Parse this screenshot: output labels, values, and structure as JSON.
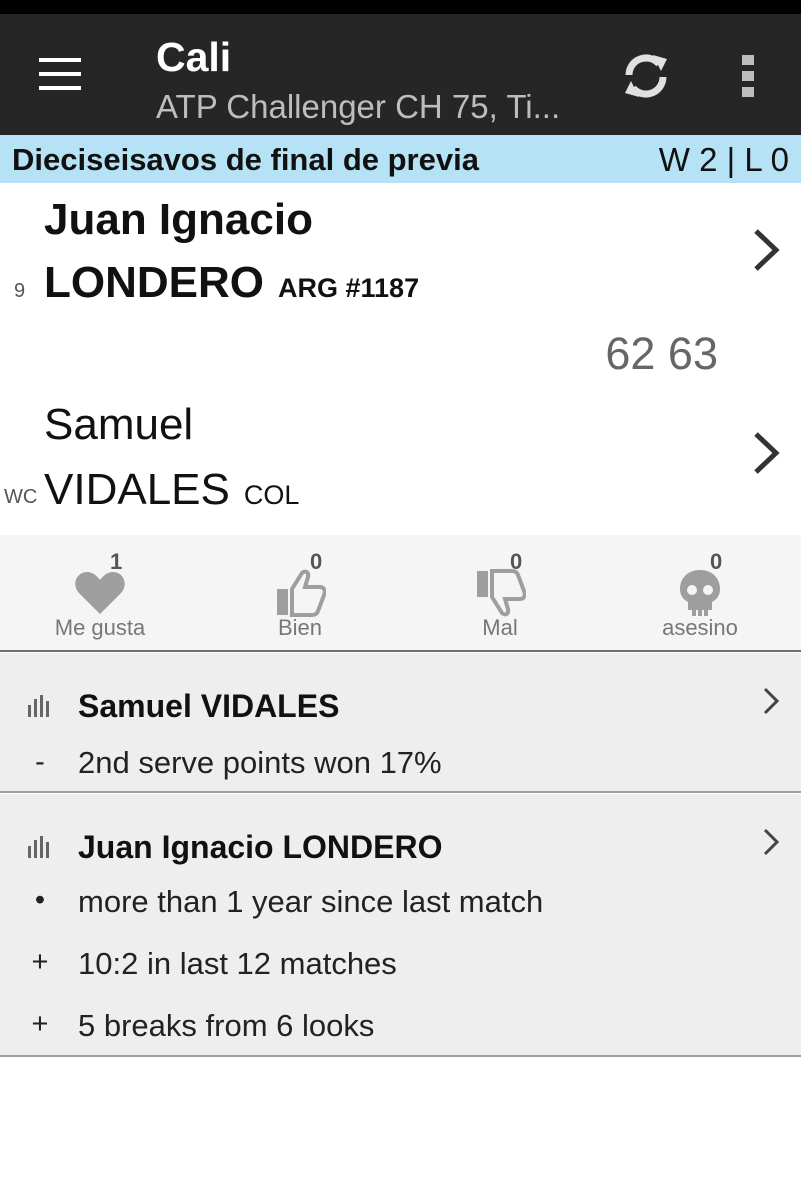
{
  "header": {
    "title": "Cali",
    "subtitle": "ATP Challenger CH 75, Ti..."
  },
  "round": {
    "label": "Dieciseisavos de final de previa",
    "record": "W 2 | L 0"
  },
  "players": [
    {
      "seed": "9",
      "first_name": "Juan Ignacio",
      "last_name": "LONDERO",
      "country_rank": "ARG #1187"
    },
    {
      "seed": "WC",
      "first_name": "Samuel",
      "last_name": "VIDALES",
      "country_rank": "COL"
    }
  ],
  "score": "62 63",
  "reactions": [
    {
      "label": "Me gusta",
      "count": "1",
      "icon": "heart-icon"
    },
    {
      "label": "Bien",
      "count": "0",
      "icon": "thumbs-up-icon"
    },
    {
      "label": "Mal",
      "count": "0",
      "icon": "thumbs-down-icon"
    },
    {
      "label": "asesino",
      "count": "0",
      "icon": "skull-icon"
    }
  ],
  "stats": [
    {
      "player": "Samuel VIDALES",
      "rows": [
        {
          "mark": "-",
          "text": "2nd serve points won 17%"
        }
      ]
    },
    {
      "player": "Juan Ignacio LONDERO",
      "rows": [
        {
          "mark": "•",
          "text": "more than 1 year since last match"
        },
        {
          "mark": "+",
          "text": "10:2 in last 12 matches"
        },
        {
          "mark": "+",
          "text": "5 breaks from 6 looks"
        }
      ]
    }
  ],
  "colors": {
    "appbar": "#262626",
    "round_bar": "#b5e3f5",
    "reaction_bg": "#f5f5f5",
    "stats_bg": "#eeeeee"
  }
}
